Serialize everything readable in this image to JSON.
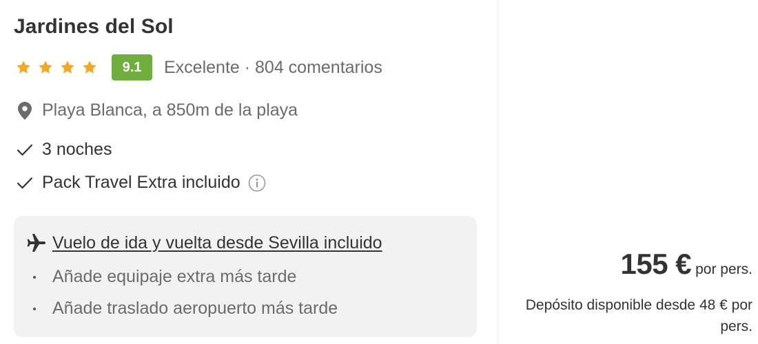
{
  "hotel": {
    "name": "Jardines del Sol",
    "stars": 4,
    "score": "9.1",
    "rating_text": "Excelente · 804 comentarios",
    "location": "Playa Blanca, a 850m de la playa",
    "features": [
      "3 noches",
      "Pack Travel Extra incluido"
    ]
  },
  "flight": {
    "title": "Vuelo de ida y vuelta desde Sevilla incluido",
    "items": [
      "Añade equipaje extra más tarde",
      "Añade traslado aeropuerto más tarde"
    ]
  },
  "price": {
    "amount": "155 €",
    "unit": "por pers.",
    "deposit": "Depósito disponible desde 48 € por pers."
  },
  "icons": {
    "star": "star-icon",
    "location": "location-pin-icon",
    "check": "check-icon",
    "info": "info-icon",
    "plane": "plane-icon"
  },
  "colors": {
    "star": "#f5a623",
    "score_badge": "#6fae3e",
    "flight_box": "#f2f2f2",
    "muted_text": "#6b6b6b"
  }
}
